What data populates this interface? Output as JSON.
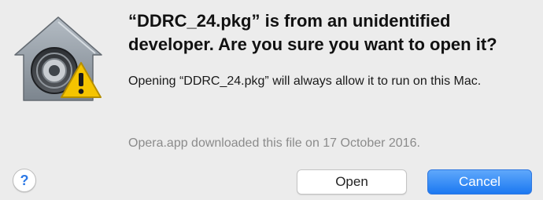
{
  "dialog": {
    "title": "“DDRC_24.pkg” is from an unidentified developer. Are you sure you want to open it?",
    "message": "Opening “DDRC_24.pkg” will always allow it to run on this Mac.",
    "source_note": "Opera.app downloaded this file on 17 October 2016.",
    "help_label": "?",
    "open_label": "Open",
    "cancel_label": "Cancel"
  },
  "icons": {
    "app": "gatekeeper-security-icon",
    "badge": "warning-icon",
    "help": "help-icon"
  },
  "colors": {
    "background": "#ececec",
    "default_button": "#1b78f1",
    "secondary_text": "#8b8b8b",
    "warning": "#f5c400"
  }
}
